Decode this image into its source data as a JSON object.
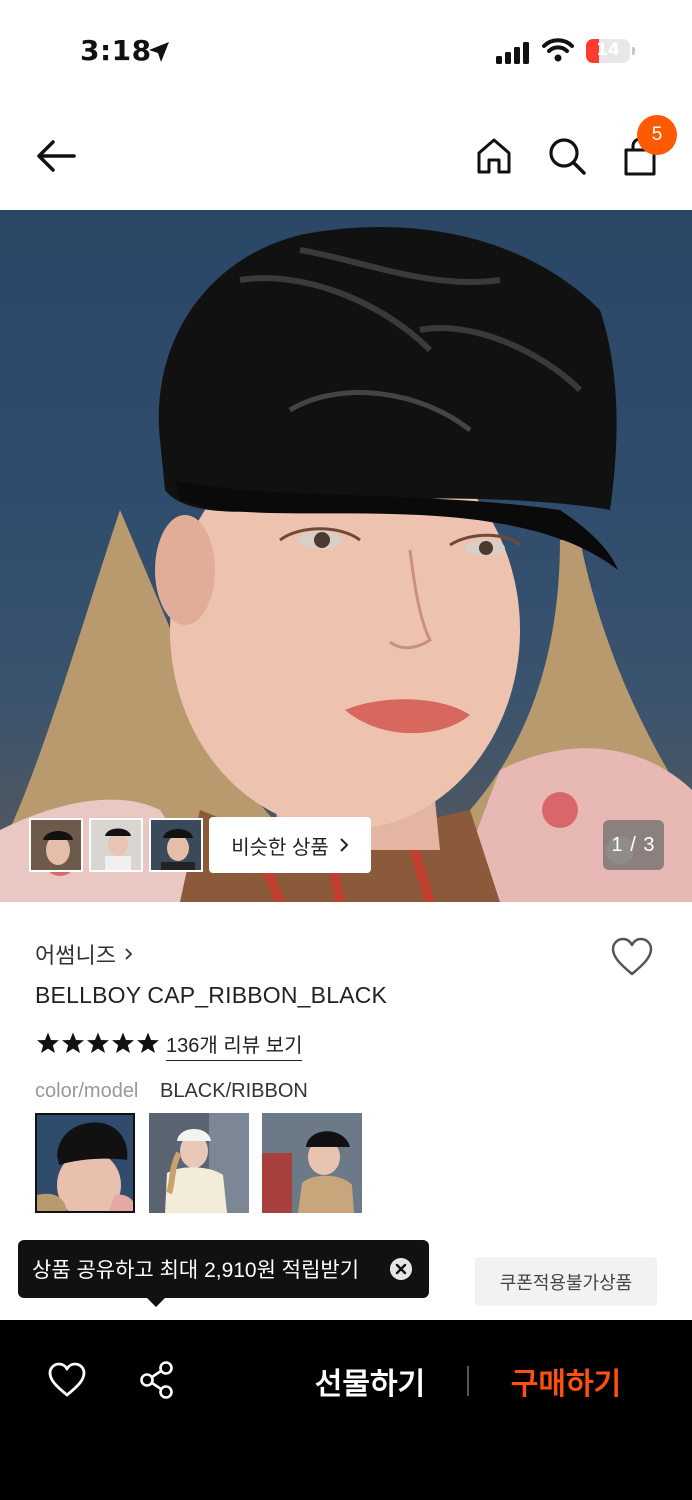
{
  "status_bar": {
    "time": "3:18",
    "battery": "14"
  },
  "nav": {
    "cart_count": "5"
  },
  "hero": {
    "page_indicator": "1 / 3",
    "similar_label": "비슷한 상품"
  },
  "product": {
    "brand": "어썸니즈",
    "name": "BELLBOY CAP_RIBBON_BLACK",
    "rating_stars": 5,
    "review_link": "136개 리뷰 보기",
    "color_label": "color/model",
    "color_value": "BLACK/RIBBON"
  },
  "tooltip": {
    "text": "상품 공유하고 최대 2,910원 적립받기"
  },
  "coupon_tag": "쿠폰적용불가상품",
  "bottom_bar": {
    "gift_label": "선물하기",
    "buy_label": "구매하기"
  },
  "colors": {
    "accent": "#ff5a00",
    "buy": "#ff4f12"
  }
}
